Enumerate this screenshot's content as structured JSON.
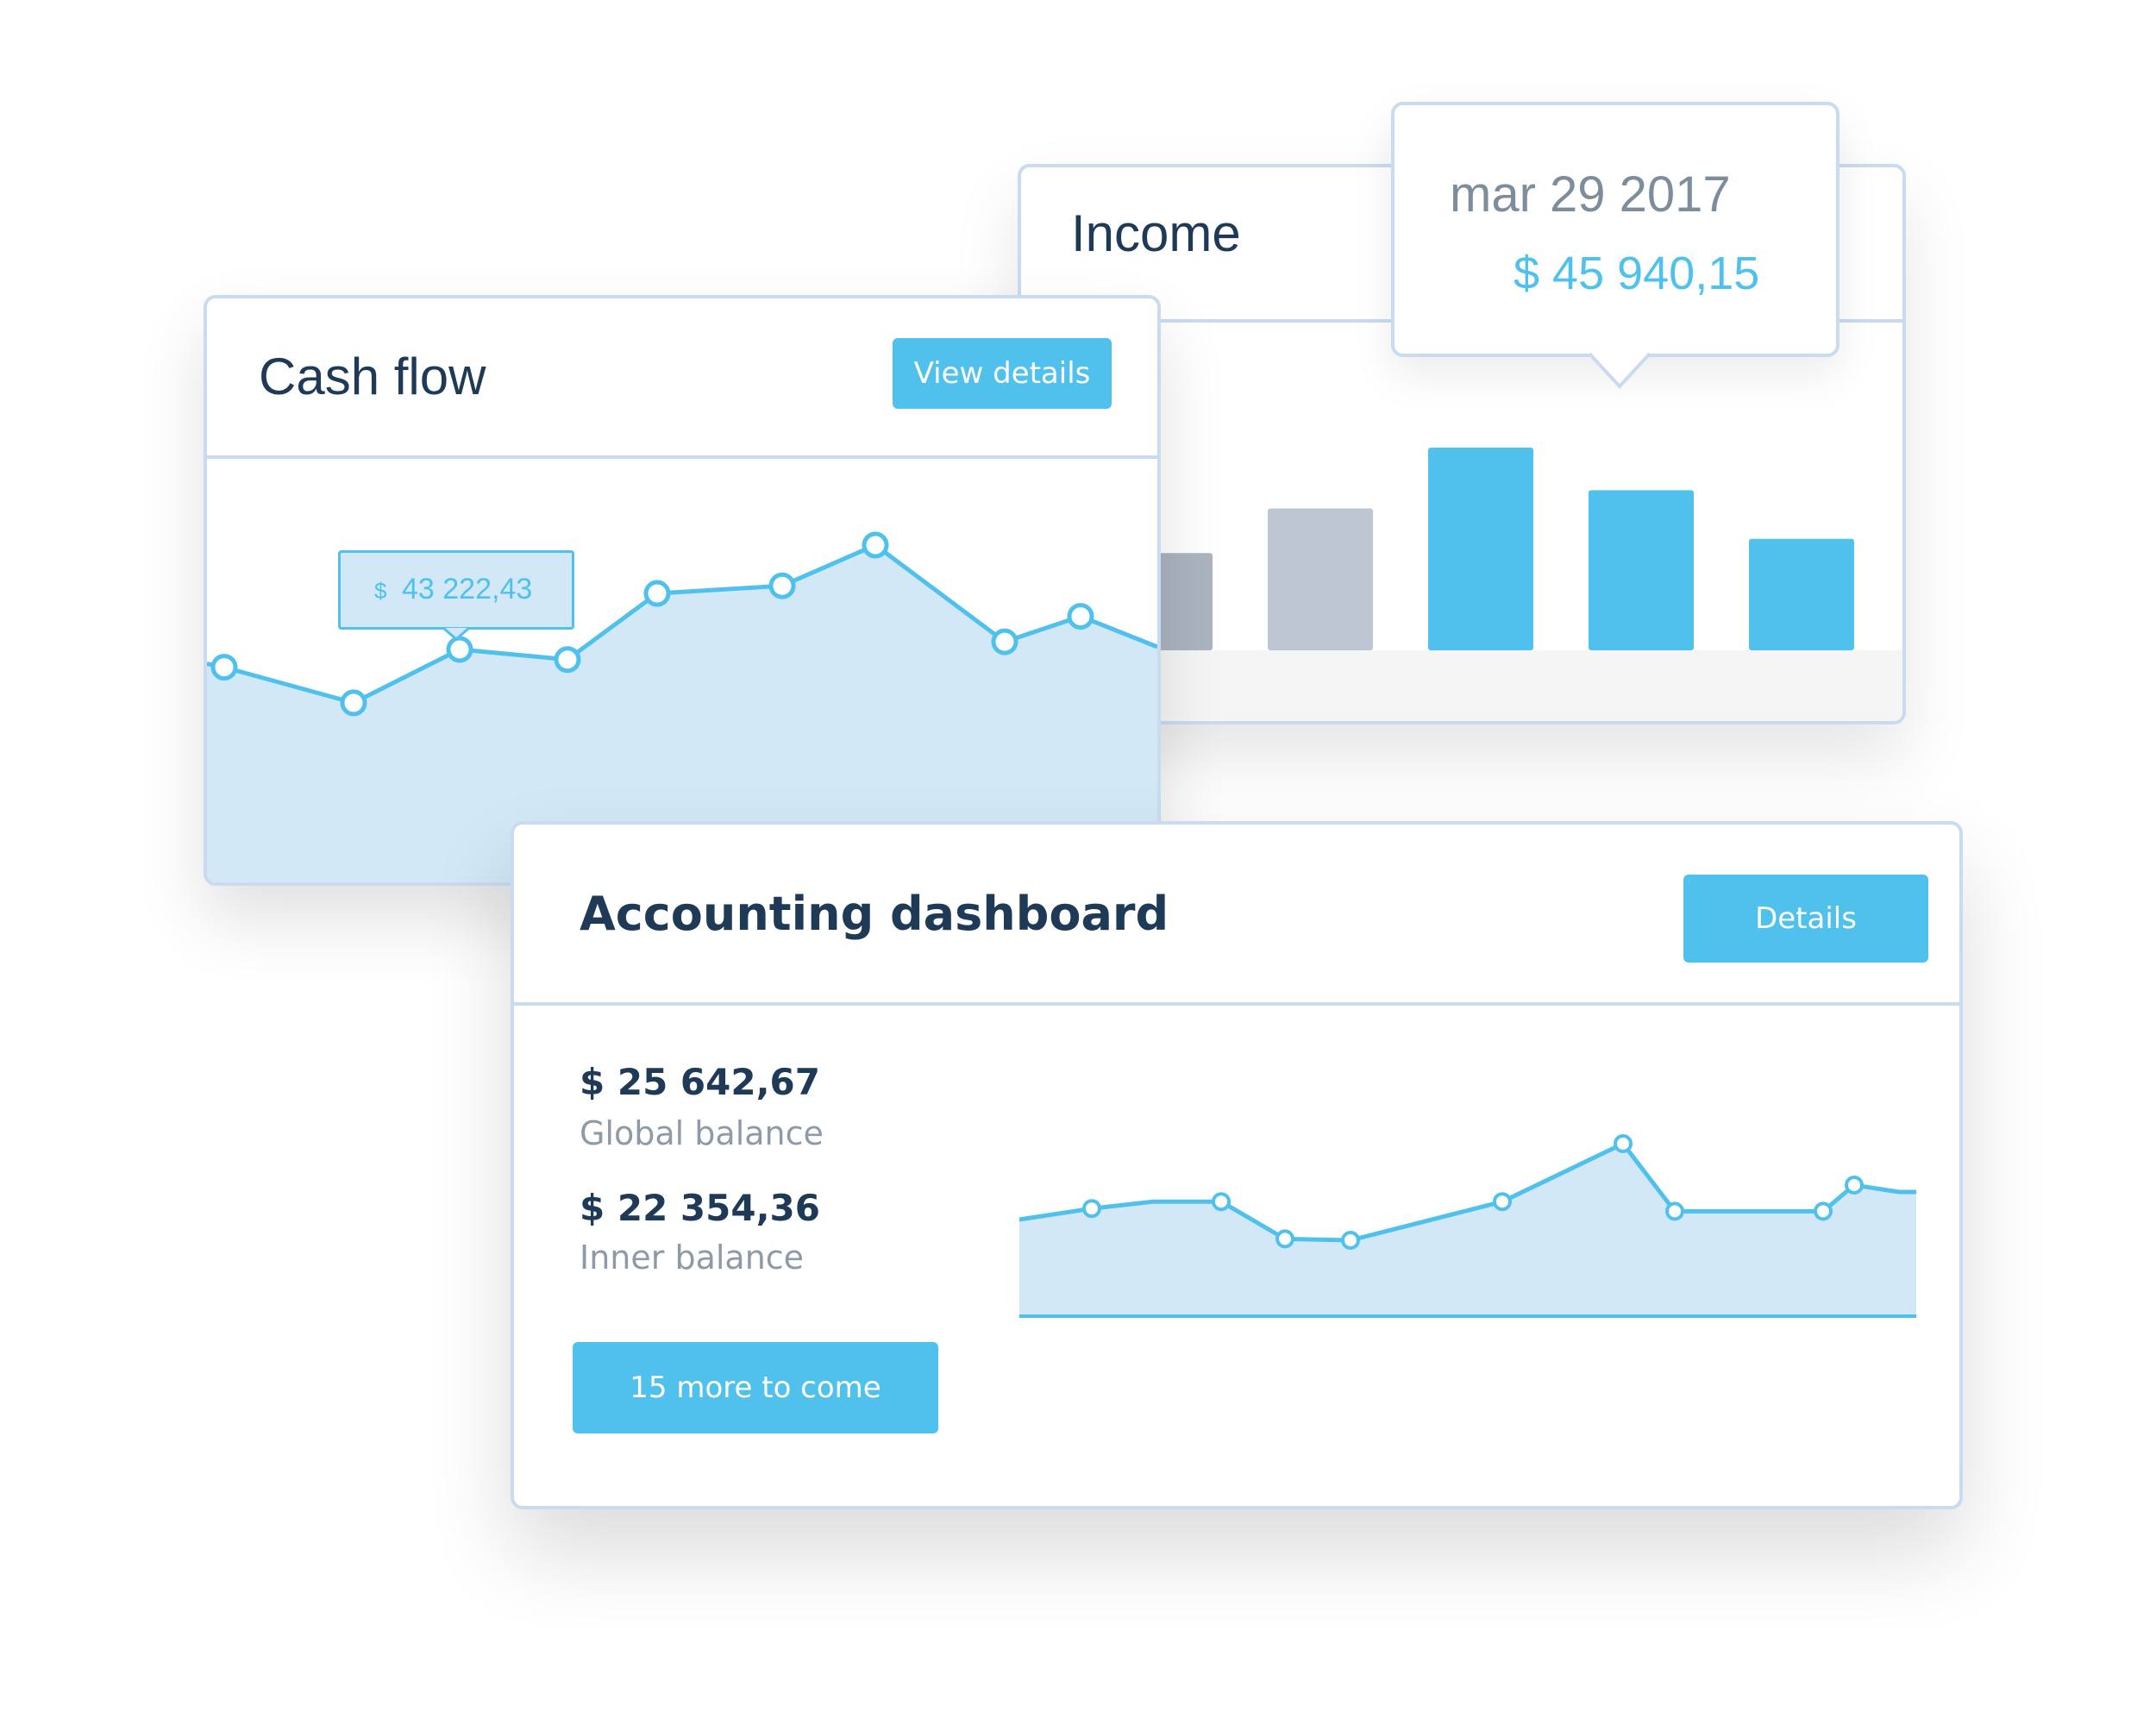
{
  "colors": {
    "accent": "#4fc1ec",
    "accent_fill": "#d2e8f6",
    "title_text": "#1f3a56",
    "muted_text": "#8e9aa7",
    "border": "#c9dbf0",
    "bar_gray": "#bec7d1",
    "bar_gray_dark": "#abb4bf"
  },
  "income": {
    "title": "Income",
    "tooltip": {
      "date": "mar 29 2017",
      "value": "$ 45 940,15"
    },
    "chart_data": {
      "type": "bar",
      "bars": [
        {
          "value": 0.48,
          "color": "#abb4bf"
        },
        {
          "value": 0.7,
          "color": "#bec7d1"
        },
        {
          "value": 1.0,
          "color": "#4fc1ec"
        },
        {
          "value": 0.79,
          "color": "#4fc1ec"
        },
        {
          "value": 0.55,
          "color": "#4fc1ec"
        }
      ]
    }
  },
  "cash_flow": {
    "title": "Cash flow",
    "button_label": "View details",
    "tooltip": {
      "currency": "$",
      "value": "43 222,43"
    },
    "chart_data": {
      "type": "area",
      "points": [
        0.52,
        0.38,
        0.59,
        0.55,
        0.81,
        0.84,
        1.0,
        0.62,
        0.72
      ],
      "end_value": 0.6
    }
  },
  "accounting": {
    "title": "Accounting dashboard",
    "button_label": "Details",
    "global_balance": {
      "value": "$ 25 642,67",
      "label": "Global balance"
    },
    "inner_balance": {
      "value": "$ 22 354,36",
      "label": "Inner balance"
    },
    "more_button_label": "15 more to come",
    "chart_data": {
      "type": "area",
      "points": [
        0.53,
        0.58,
        0.31,
        0.3,
        0.58,
        1.0,
        0.51,
        0.51,
        0.7
      ],
      "start_value": 0.45,
      "end_value": 0.65
    }
  }
}
